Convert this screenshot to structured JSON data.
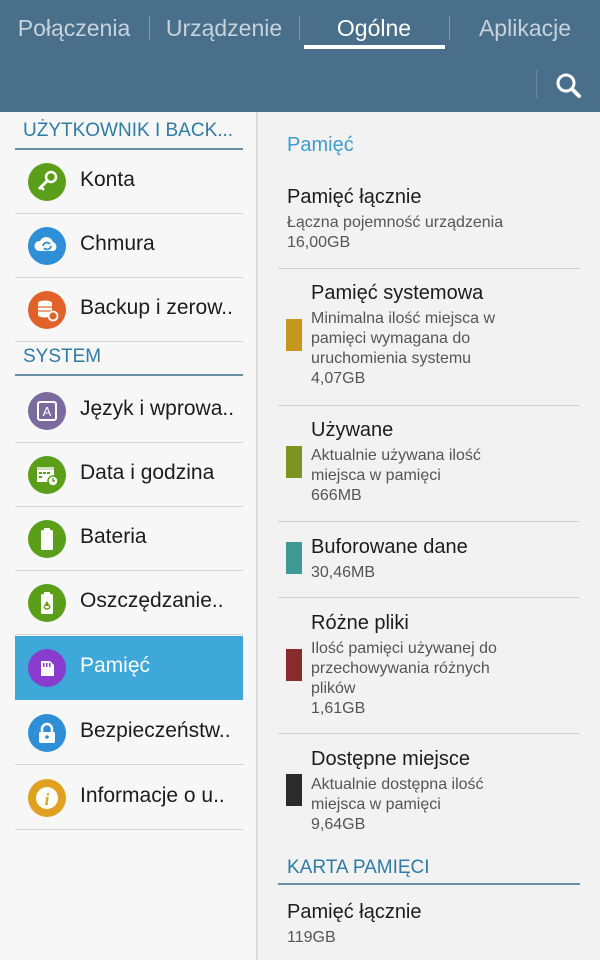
{
  "tabs": [
    {
      "label": "Połączenia"
    },
    {
      "label": "Urządzenie"
    },
    {
      "label": "Ogólne"
    },
    {
      "label": "Aplikacje"
    }
  ],
  "active_tab": "Ogólne",
  "sidebar": {
    "sections": [
      {
        "title": "UŻYTKOWNIK I BACK..."
      },
      {
        "title": "SYSTEM"
      }
    ],
    "items": [
      {
        "label": "Konta",
        "icon": "key-icon",
        "color": "#5a9e1a"
      },
      {
        "label": "Chmura",
        "icon": "cloud-sync-icon",
        "color": "#2f8fd6"
      },
      {
        "label": "Backup i zerow..",
        "icon": "backup-icon",
        "color": "#e0622a"
      },
      {
        "label": "Język i wprowa..",
        "icon": "language-icon",
        "color": "#7a6a9e"
      },
      {
        "label": "Data i godzina",
        "icon": "calendar-clock-icon",
        "color": "#5a9e1a"
      },
      {
        "label": "Bateria",
        "icon": "battery-icon",
        "color": "#5a9e1a"
      },
      {
        "label": "Oszczędzanie..",
        "icon": "power-saving-icon",
        "color": "#5a9e1a"
      },
      {
        "label": "Pamięć",
        "icon": "sd-card-icon",
        "color": "#8a3ccf",
        "active": true
      },
      {
        "label": "Bezpieczeństw..",
        "icon": "lock-icon",
        "color": "#2f8fd6"
      },
      {
        "label": "Informacje o u..",
        "icon": "info-icon",
        "color": "#e0a020"
      }
    ]
  },
  "main": {
    "title": "Pamięć",
    "total": {
      "heading": "Pamięć łącznie",
      "sub": "Łączna pojemność urządzenia",
      "value": "16,00GB"
    },
    "entries": [
      {
        "heading": "Pamięć systemowa",
        "sub": [
          "Minimalna ilość miejsca w",
          "pamięci wymagana do",
          "uruchomienia systemu"
        ],
        "value": "4,07GB",
        "color": "#c4971d"
      },
      {
        "heading": "Używane",
        "sub": [
          "Aktualnie używana ilość",
          "miejsca w pamięci"
        ],
        "value": "666MB",
        "color": "#7e9420"
      },
      {
        "heading": "Buforowane dane",
        "sub": [],
        "value": "30,46MB",
        "color": "#3f9a97"
      },
      {
        "heading": "Różne pliki",
        "sub": [
          "Ilość pamięci używanej do",
          "przechowywania różnych",
          "plików"
        ],
        "value": "1,61GB",
        "color": "#8a2b2b"
      },
      {
        "heading": "Dostępne miejsce",
        "sub": [
          "Aktualnie dostępna ilość",
          "miejsca w pamięci"
        ],
        "value": "9,64GB",
        "color": "#2b2b2b"
      }
    ],
    "card_section": {
      "title": "KARTA PAMIĘCI"
    },
    "card_total": {
      "heading": "Pamięć łącznie",
      "value": "119GB"
    }
  },
  "colors": {
    "topbar": "#4a6f8a",
    "active_item": "#3ea9d8",
    "accent": "#3f9ccd",
    "section": "#2f7ba3"
  }
}
